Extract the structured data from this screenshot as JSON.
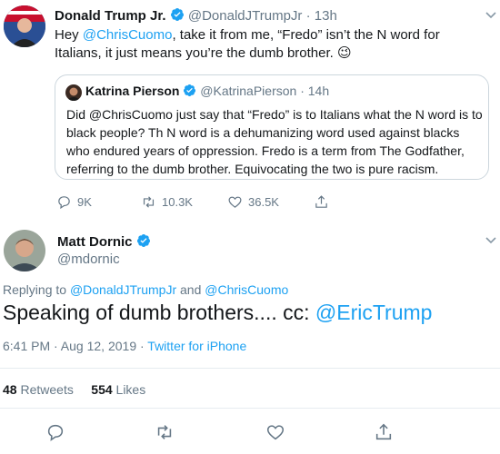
{
  "parent_tweet": {
    "name": "Donald Trump Jr.",
    "handle": "@DonaldJTrumpJr",
    "separator": "·",
    "time": "13h",
    "text_prefix": "Hey ",
    "mention": "@ChrisCuomo",
    "text_rest": ", take it from me, “Fredo” isn’t the N word for Italians, it just means you’re the dumb brother.",
    "emoji": "😉",
    "actions": {
      "replies": "9K",
      "retweets": "10.3K",
      "likes": "36.5K"
    }
  },
  "quoted_tweet": {
    "name": "Katrina Pierson",
    "handle": "@KatrinaPierson",
    "separator": "·",
    "time": "14h",
    "text": "Did @ChrisCuomo  just say that “Fredo” is to Italians what the N word is to black people? Th N word is a dehumanizing word used against blacks who endured years of oppression. Fredo is a term from The Godfather, referring to the dumb brother. Equivocating the two is pure racism."
  },
  "main_tweet": {
    "name": "Matt Dornic",
    "handle": "@mdornic",
    "replying_label": "Replying to ",
    "replying_to_1": "@DonaldJTrumpJr",
    "replying_and": " and ",
    "replying_to_2": "@ChrisCuomo",
    "text": "Speaking of dumb brothers.... cc: ",
    "text_mention": "@EricTrump",
    "timestamp": "6:41 PM · Aug 12, 2019 · ",
    "source": "Twitter for iPhone",
    "retweet_count": "48",
    "retweet_label": "Retweets",
    "like_count": "554",
    "like_label": "Likes"
  },
  "colors": {
    "link": "#1da1f2",
    "muted": "#657786",
    "text": "#14171a",
    "border": "#e6ecf0",
    "verified": "#1da1f2"
  },
  "icons": [
    "verified-badge-icon",
    "chevron-down-icon",
    "reply-icon",
    "retweet-icon",
    "like-icon",
    "share-icon"
  ]
}
